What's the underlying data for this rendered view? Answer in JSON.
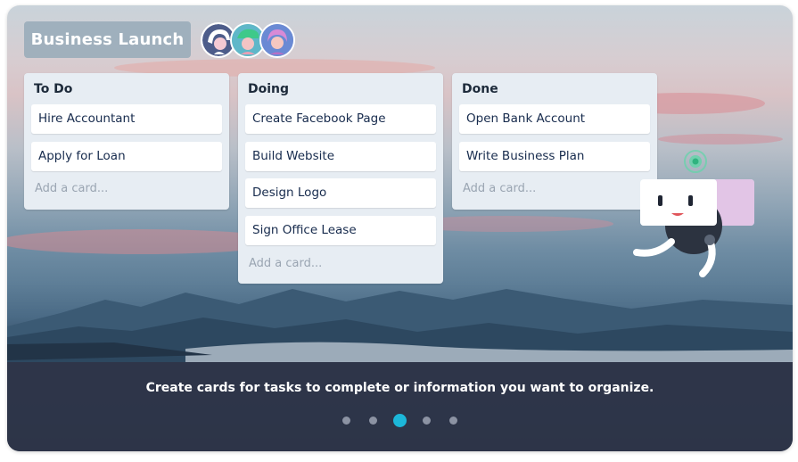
{
  "board": {
    "title": "Business Launch"
  },
  "lists": [
    {
      "title": "To Do",
      "cards": [
        "Hire Accountant",
        "Apply for Loan"
      ],
      "add_card": "Add a card..."
    },
    {
      "title": "Doing",
      "cards": [
        "Create Facebook Page",
        "Build Website",
        "Design Logo",
        "Sign Office Lease"
      ],
      "add_card": "Add a card..."
    },
    {
      "title": "Done",
      "cards": [
        "Open Bank Account",
        "Write Business Plan"
      ],
      "add_card": "Add a card..."
    }
  ],
  "caption": "Create cards for tasks to complete or information you want to organize.",
  "carousel": {
    "total": 5,
    "active_index": 2
  },
  "colors": {
    "accent": "#1cb7d9",
    "list_bg": "#e7edf3",
    "caption_bg": "#2e3448"
  }
}
